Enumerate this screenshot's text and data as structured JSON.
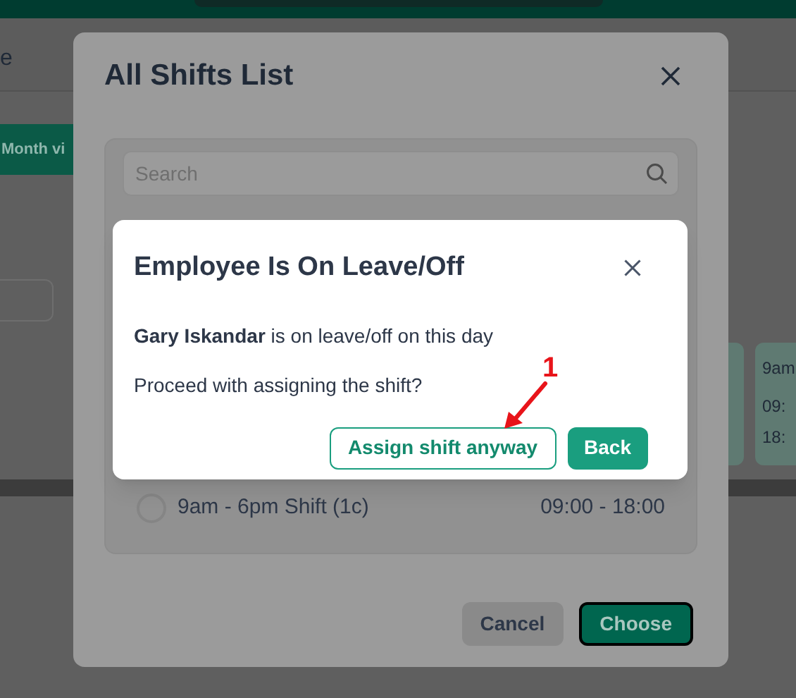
{
  "background": {
    "header_fragment": "e",
    "month_button": "Month vi",
    "card": {
      "line_1": "9am",
      "line_2": "09:",
      "line_3": "18:"
    }
  },
  "shifts_dialog": {
    "title": "All Shifts List",
    "search": {
      "placeholder": "Search"
    },
    "shifts": [
      {
        "name": "9am - 6pm Shift (1c)",
        "time": "09:00 - 18:00",
        "selected": false
      }
    ],
    "buttons": [
      {
        "label": "Cancel",
        "kind": "secondary"
      },
      {
        "label": "Choose",
        "kind": "primary"
      }
    ]
  },
  "leave_dialog": {
    "title": "Employee Is On Leave/Off",
    "message": "**Gary Iskandar** is on leave/off on this day",
    "question": "Proceed with assigning the shift?",
    "buttons": [
      {
        "label": "Assign shift anyway",
        "kind": "outline"
      },
      {
        "label": "Back",
        "kind": "primary"
      }
    ]
  },
  "annotation": {
    "label": "1"
  }
}
